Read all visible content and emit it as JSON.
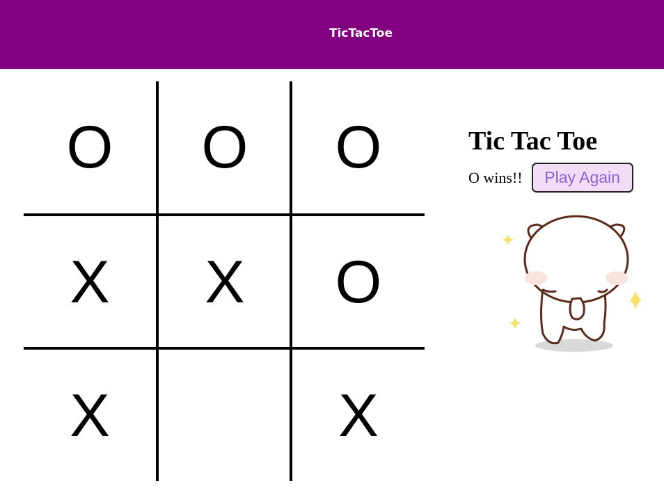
{
  "header": {
    "title": "TicTacToe"
  },
  "board": {
    "cells": [
      "O",
      "O",
      "O",
      "X",
      "X",
      "O",
      "X",
      "",
      "X"
    ]
  },
  "side": {
    "title": "Tic Tac Toe",
    "status": "O wins!!",
    "play_again_label": "Play Again"
  },
  "colors": {
    "header_bg": "#800080",
    "button_bg": "#f3dcf7",
    "button_text": "#8a63d2"
  },
  "illustration": {
    "icon": "cat-sticker-icon"
  }
}
